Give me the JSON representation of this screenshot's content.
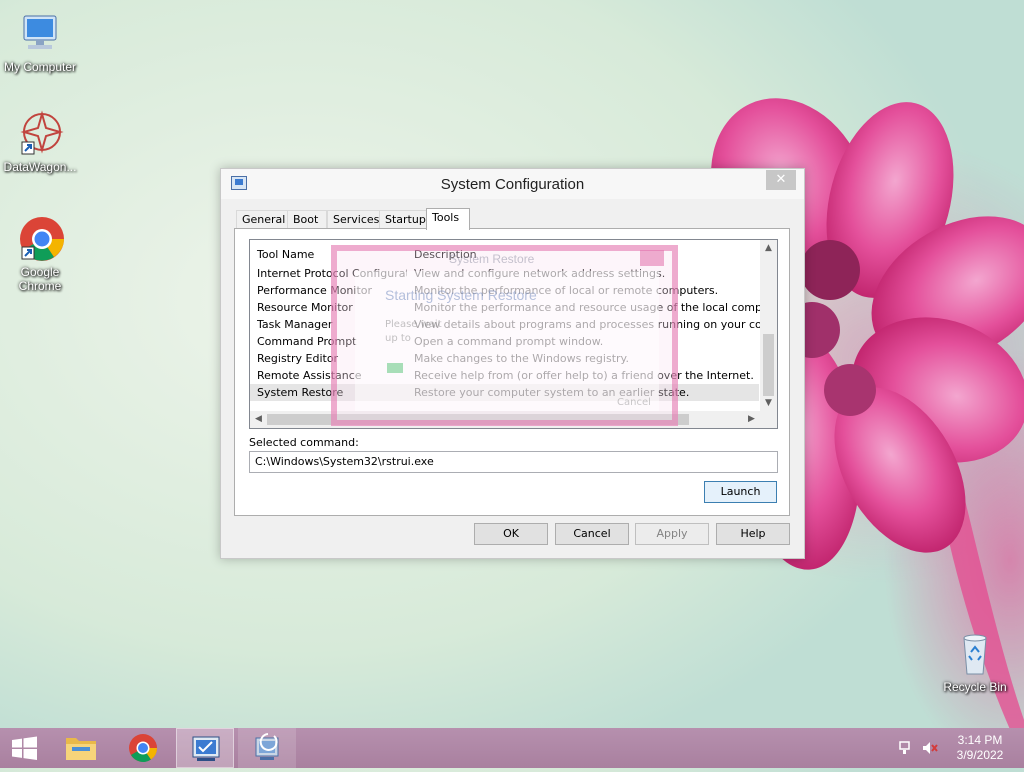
{
  "desktop": {
    "icons": [
      {
        "label": "My Computer"
      },
      {
        "label": "DataWagon..."
      },
      {
        "label": "Google Chrome"
      },
      {
        "label": "Recycle Bin"
      }
    ]
  },
  "window": {
    "title": "System Configuration",
    "close_glyph": "✕",
    "tabs": [
      {
        "label": "General"
      },
      {
        "label": "Boot"
      },
      {
        "label": "Services"
      },
      {
        "label": "Startup"
      },
      {
        "label": "Tools",
        "active": true
      }
    ],
    "list": {
      "headers": {
        "name": "Tool Name",
        "description": "Description"
      },
      "rows": [
        {
          "name": "Internet Protocol Configurat...",
          "description": "View and configure network address settings."
        },
        {
          "name": "Performance Monitor",
          "description": "Monitor the performance of local or remote computers."
        },
        {
          "name": "Resource Monitor",
          "description": "Monitor the performance and resource usage of the local computer."
        },
        {
          "name": "Task Manager",
          "description": "View details about programs and processes running on your computer."
        },
        {
          "name": "Command Prompt",
          "description": "Open a command prompt window."
        },
        {
          "name": "Registry Editor",
          "description": "Make changes to the Windows registry."
        },
        {
          "name": "Remote Assistance",
          "description": "Receive help from (or offer help to) a friend over the Internet."
        },
        {
          "name": "System Restore",
          "description": "Restore your computer system to an earlier state.",
          "selected": true
        }
      ]
    },
    "ghost_dialog": {
      "title": "System Restore",
      "heading": "Starting System Restore",
      "line1": "Please wait",
      "line2": "up to",
      "cancel": "Cancel"
    },
    "selected_command_label": "Selected command:",
    "selected_command": "C:\\Windows\\System32\\rstrui.exe",
    "launch_label": "Launch",
    "buttons": {
      "ok": "OK",
      "cancel": "Cancel",
      "apply": "Apply",
      "help": "Help"
    }
  },
  "taskbar": {
    "time": "3:14 PM",
    "date": "3/9/2022"
  },
  "colors": {
    "taskbar": "#a9809f",
    "selection": "#e5e5e5",
    "primary_button_border": "#3c7fb1"
  }
}
